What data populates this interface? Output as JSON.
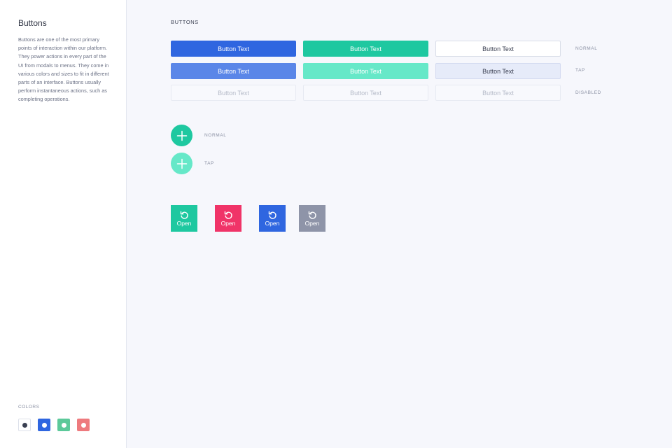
{
  "sidebar": {
    "title": "Buttons",
    "description": "Buttons are one of the most primary points of interaction within our platform. They power actions in every part of the UI from modals to menus. They come in various colors and sizes to fit in different parts of an interface. Buttons usually perform instantaneous actions, such as completing operations.",
    "colors_label": "COLORS",
    "colors": [
      {
        "name": "dark",
        "box": "#ffffff",
        "dot": "#3a3f51",
        "border": "#dde1ea"
      },
      {
        "name": "blue",
        "box": "#2f66e0",
        "dot": "#ffffff",
        "border": "#2f66e0"
      },
      {
        "name": "green",
        "box": "#5cc99a",
        "dot": "#ffffff",
        "border": "#5cc99a"
      },
      {
        "name": "red",
        "box": "#ee7a7e",
        "dot": "#ffffff",
        "border": "#ee7a7e"
      }
    ]
  },
  "main": {
    "section_title": "BUTTONS",
    "button_text": "Button Text",
    "row_labels": {
      "normal": "NORMAL",
      "tap": "TAP",
      "disabled": "DISABLED"
    },
    "fab_labels": {
      "normal": "NORMAL",
      "tap": "TAP"
    },
    "open_tiles": [
      {
        "label": "Open",
        "color": "#1ec8a0"
      },
      {
        "label": "Open",
        "color": "#f03468"
      },
      {
        "label": "Open",
        "color": "#2f66e0"
      },
      {
        "label": "Open",
        "color": "#8e94a8"
      }
    ],
    "colors": {
      "primary": "#2f66e0",
      "primary_tap": "#5a86e8",
      "success": "#1ec8a0",
      "success_tap": "#66e8c8",
      "secondary_tap": "#e6ebf9"
    }
  }
}
